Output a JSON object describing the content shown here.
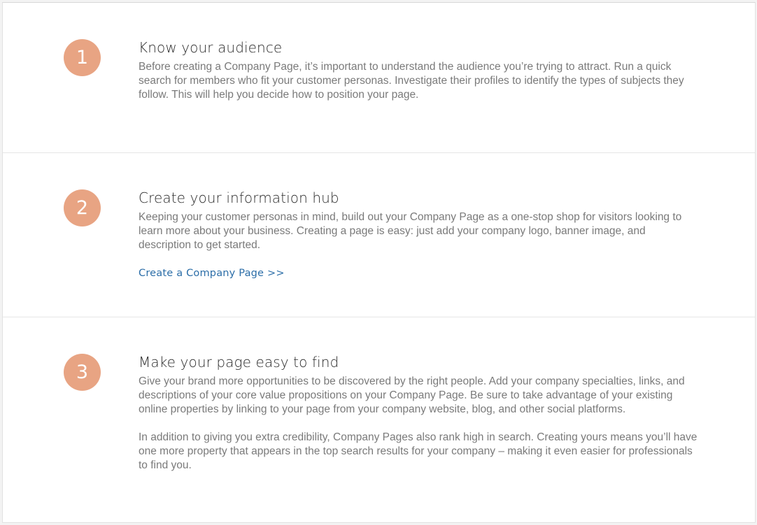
{
  "steps": [
    {
      "number": "1",
      "title": "Know your audience",
      "body": "Before creating a Company Page, it’s important to understand the audience you’re trying to attract. Run a quick search for members who fit your customer personas. Investigate their profiles to identify the types of subjects they follow. This will help you decide how to position your page."
    },
    {
      "number": "2",
      "title": "Create your information hub",
      "body": "Keeping your customer personas in mind, build out your Company Page as a one-stop shop for visitors looking to learn more about your business. Creating a page is easy: just add your company logo, banner image, and description to get started.",
      "link": "Create a Company Page >>"
    },
    {
      "number": "3",
      "title": "Make your page easy to find",
      "body": "Give your brand more opportunities to be discovered by the right people. Add your company specialties, links, and descriptions of your core value propositions on your Company Page. Be sure to take advantage of your existing online properties by linking to your page from your company website, blog, and other social platforms.",
      "body2": "In addition to giving you extra credibility, Company Pages also rank high in search. Creating yours means you’ll have one more property that appears in the top search results for your company – making it even easier for professionals to find you."
    }
  ],
  "colors": {
    "accent_circle": "#e8a483",
    "link": "#2c6ea8",
    "title": "#2b2b2b",
    "body": "#7a7a7a"
  }
}
